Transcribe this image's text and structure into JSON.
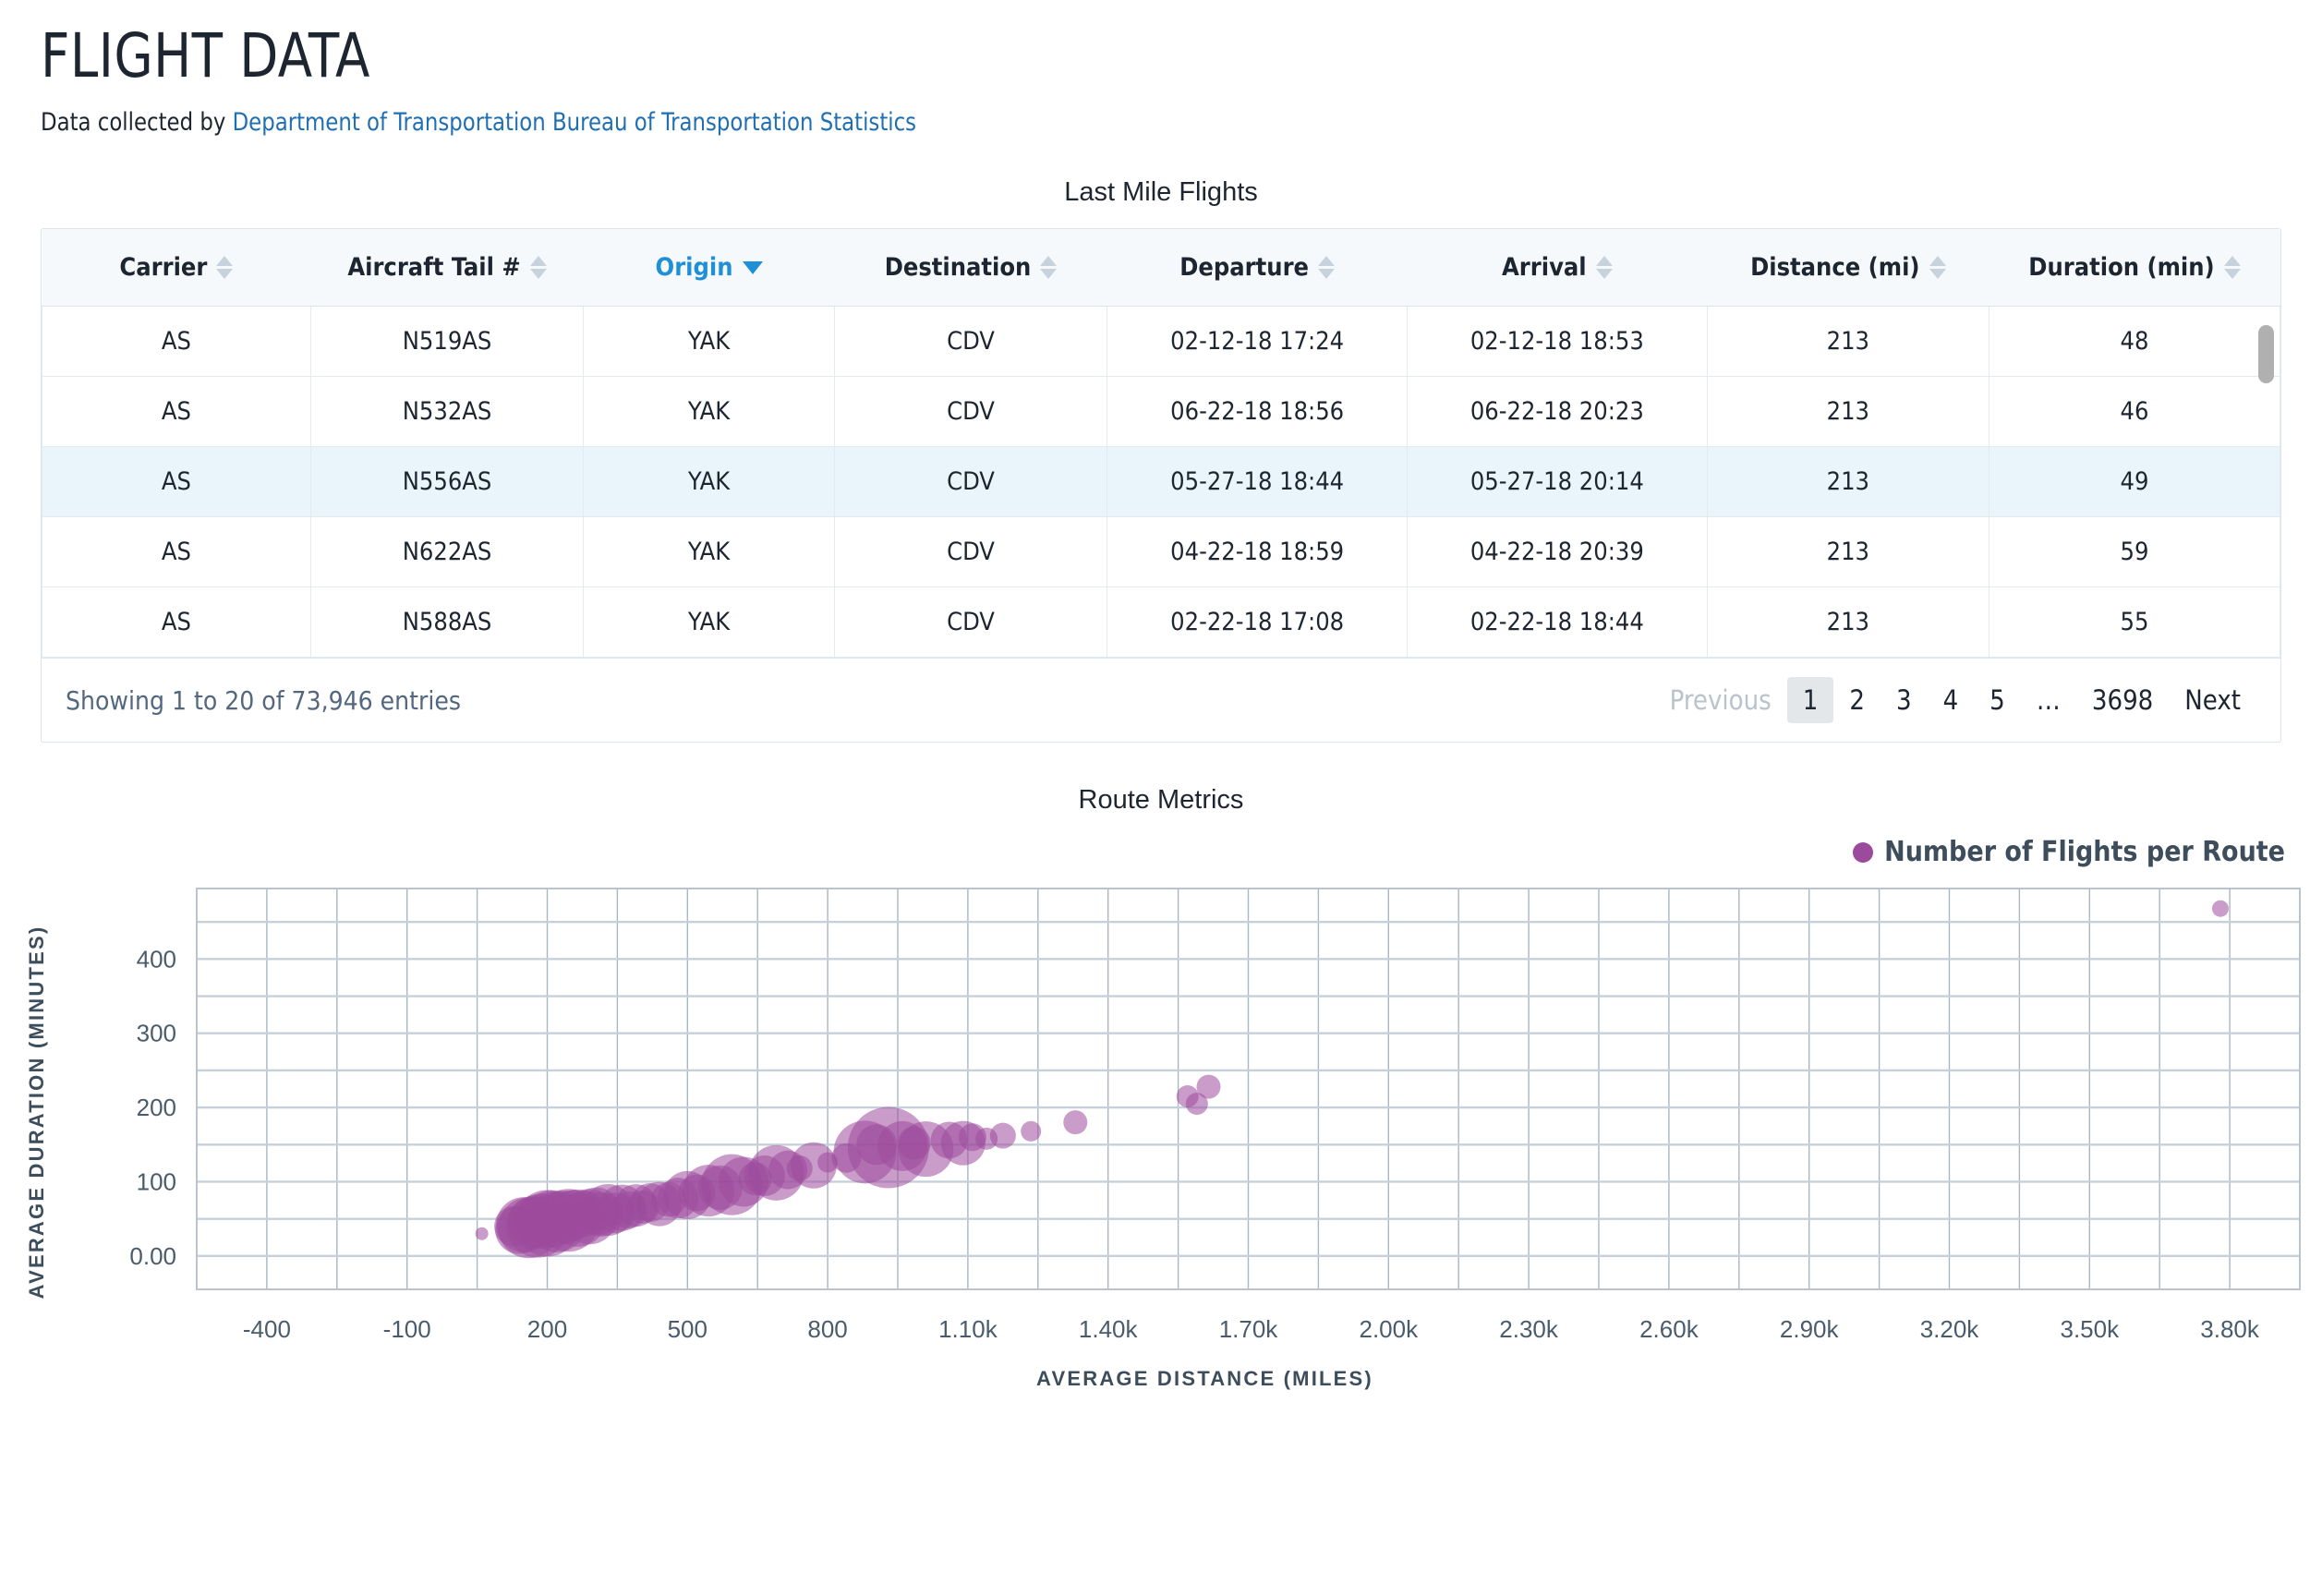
{
  "header": {
    "title": "FLIGHT DATA",
    "subtitle_prefix": "Data collected by ",
    "subtitle_link": "Department of Transportation Bureau of Transportation Statistics"
  },
  "table": {
    "title": "Last Mile Flights",
    "columns": [
      {
        "label": "Carrier",
        "sorted": false
      },
      {
        "label": "Aircraft Tail #",
        "sorted": false
      },
      {
        "label": "Origin",
        "sorted": true,
        "direction": "desc"
      },
      {
        "label": "Destination",
        "sorted": false
      },
      {
        "label": "Departure",
        "sorted": false
      },
      {
        "label": "Arrival",
        "sorted": false
      },
      {
        "label": "Distance (mi)",
        "sorted": false
      },
      {
        "label": "Duration (min)",
        "sorted": false
      }
    ],
    "rows": [
      {
        "cells": [
          "AS",
          "N519AS",
          "YAK",
          "CDV",
          "02-12-18 17:24",
          "02-12-18 18:53",
          "213",
          "48"
        ],
        "highlight": false
      },
      {
        "cells": [
          "AS",
          "N532AS",
          "YAK",
          "CDV",
          "06-22-18 18:56",
          "06-22-18 20:23",
          "213",
          "46"
        ],
        "highlight": false
      },
      {
        "cells": [
          "AS",
          "N556AS",
          "YAK",
          "CDV",
          "05-27-18 18:44",
          "05-27-18 20:14",
          "213",
          "49"
        ],
        "highlight": true
      },
      {
        "cells": [
          "AS",
          "N622AS",
          "YAK",
          "CDV",
          "04-22-18 18:59",
          "04-22-18 20:39",
          "213",
          "59"
        ],
        "highlight": false
      },
      {
        "cells": [
          "AS",
          "N588AS",
          "YAK",
          "CDV",
          "02-22-18 17:08",
          "02-22-18 18:44",
          "213",
          "55"
        ],
        "highlight": false
      }
    ],
    "footer": {
      "showing": "Showing 1 to 20 of 73,946 entries",
      "previous": "Previous",
      "pages": [
        "1",
        "2",
        "3",
        "4",
        "5",
        "…",
        "3698"
      ],
      "active_page": "1",
      "next": "Next"
    }
  },
  "chart": {
    "title": "Route Metrics",
    "legend": "Number of Flights per Route",
    "accent_color": "#9c4a9c"
  },
  "chart_data": {
    "type": "scatter",
    "title": "Route Metrics",
    "xlabel": "AVERAGE DISTANCE (MILES)",
    "ylabel": "AVERAGE DURATION (MINUTES)",
    "legend": [
      {
        "name": "Number of Flights per Route",
        "color": "#9c4a9c"
      }
    ],
    "legend_position": "top-right",
    "grid": true,
    "xlim": [
      -550,
      3950
    ],
    "ylim": [
      -45,
      495
    ],
    "xticks": [
      -400,
      -100,
      200,
      500,
      800,
      1100,
      1400,
      1700,
      2000,
      2300,
      2600,
      2900,
      3200,
      3500,
      3800
    ],
    "xticklabels": [
      "-400",
      "-100",
      "200",
      "500",
      "800",
      "1.10k",
      "1.40k",
      "1.70k",
      "2.00k",
      "2.30k",
      "2.60k",
      "2.90k",
      "3.20k",
      "3.50k",
      "3.80k"
    ],
    "yticks": [
      0,
      100,
      200,
      300,
      400
    ],
    "yticklabels": [
      "0.00",
      "100",
      "200",
      "300",
      "400"
    ],
    "size_encoding": "bubble radius = number of flights per route",
    "points": [
      {
        "x": 60,
        "y": 30,
        "r": 7
      },
      {
        "x": 130,
        "y": 40,
        "r": 22
      },
      {
        "x": 140,
        "y": 35,
        "r": 26
      },
      {
        "x": 150,
        "y": 42,
        "r": 30
      },
      {
        "x": 160,
        "y": 38,
        "r": 33
      },
      {
        "x": 170,
        "y": 45,
        "r": 28
      },
      {
        "x": 180,
        "y": 40,
        "r": 34
      },
      {
        "x": 190,
        "y": 47,
        "r": 30
      },
      {
        "x": 200,
        "y": 44,
        "r": 36
      },
      {
        "x": 210,
        "y": 50,
        "r": 31
      },
      {
        "x": 220,
        "y": 46,
        "r": 33
      },
      {
        "x": 235,
        "y": 52,
        "r": 29
      },
      {
        "x": 245,
        "y": 48,
        "r": 34
      },
      {
        "x": 255,
        "y": 55,
        "r": 27
      },
      {
        "x": 265,
        "y": 51,
        "r": 31
      },
      {
        "x": 280,
        "y": 57,
        "r": 25
      },
      {
        "x": 290,
        "y": 53,
        "r": 30
      },
      {
        "x": 305,
        "y": 60,
        "r": 26
      },
      {
        "x": 315,
        "y": 56,
        "r": 24
      },
      {
        "x": 330,
        "y": 62,
        "r": 28
      },
      {
        "x": 345,
        "y": 58,
        "r": 22
      },
      {
        "x": 360,
        "y": 65,
        "r": 25
      },
      {
        "x": 375,
        "y": 62,
        "r": 20
      },
      {
        "x": 390,
        "y": 68,
        "r": 23
      },
      {
        "x": 405,
        "y": 66,
        "r": 18
      },
      {
        "x": 420,
        "y": 72,
        "r": 21
      },
      {
        "x": 440,
        "y": 70,
        "r": 24
      },
      {
        "x": 460,
        "y": 76,
        "r": 19
      },
      {
        "x": 480,
        "y": 78,
        "r": 22
      },
      {
        "x": 500,
        "y": 82,
        "r": 26
      },
      {
        "x": 520,
        "y": 85,
        "r": 20
      },
      {
        "x": 545,
        "y": 88,
        "r": 28
      },
      {
        "x": 570,
        "y": 92,
        "r": 24
      },
      {
        "x": 595,
        "y": 96,
        "r": 33
      },
      {
        "x": 620,
        "y": 100,
        "r": 27
      },
      {
        "x": 645,
        "y": 104,
        "r": 18
      },
      {
        "x": 665,
        "y": 108,
        "r": 22
      },
      {
        "x": 690,
        "y": 112,
        "r": 30
      },
      {
        "x": 715,
        "y": 116,
        "r": 21
      },
      {
        "x": 740,
        "y": 118,
        "r": 14
      },
      {
        "x": 770,
        "y": 122,
        "r": 25
      },
      {
        "x": 800,
        "y": 126,
        "r": 11
      },
      {
        "x": 840,
        "y": 132,
        "r": 16
      },
      {
        "x": 880,
        "y": 140,
        "r": 34
      },
      {
        "x": 905,
        "y": 150,
        "r": 22
      },
      {
        "x": 930,
        "y": 146,
        "r": 44
      },
      {
        "x": 960,
        "y": 148,
        "r": 27
      },
      {
        "x": 985,
        "y": 152,
        "r": 18
      },
      {
        "x": 1010,
        "y": 144,
        "r": 30
      },
      {
        "x": 1060,
        "y": 156,
        "r": 20
      },
      {
        "x": 1090,
        "y": 152,
        "r": 24
      },
      {
        "x": 1110,
        "y": 160,
        "r": 15
      },
      {
        "x": 1140,
        "y": 158,
        "r": 12
      },
      {
        "x": 1175,
        "y": 162,
        "r": 14
      },
      {
        "x": 1235,
        "y": 168,
        "r": 11
      },
      {
        "x": 1330,
        "y": 180,
        "r": 13
      },
      {
        "x": 1570,
        "y": 215,
        "r": 12
      },
      {
        "x": 1590,
        "y": 205,
        "r": 12
      },
      {
        "x": 1615,
        "y": 228,
        "r": 13
      },
      {
        "x": 3780,
        "y": 468,
        "r": 9
      }
    ]
  }
}
